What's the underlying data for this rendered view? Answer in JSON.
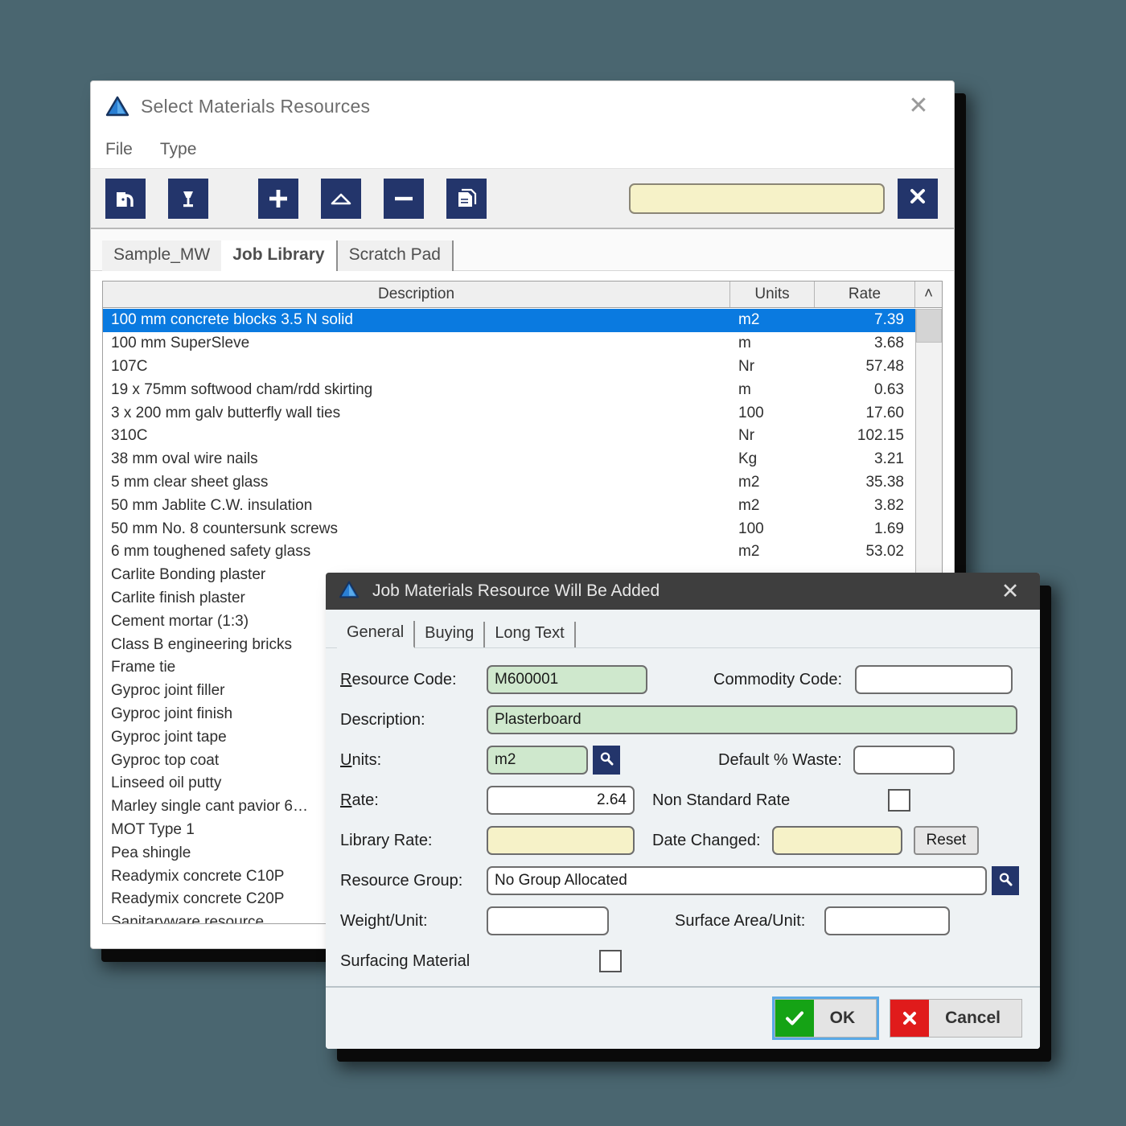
{
  "desktop": {
    "background_color": "#4a6670"
  },
  "window1": {
    "title": "Select Materials Resources",
    "icon": "triangle-app-icon",
    "close_label": "✕",
    "menu": [
      {
        "label": "File"
      },
      {
        "label": "Type"
      }
    ],
    "toolbar": {
      "buttons": [
        {
          "name": "exit-door-button",
          "icon": "exit-door-icon"
        },
        {
          "name": "lamp-button",
          "icon": "lamp-icon"
        },
        {
          "name": "add-button",
          "icon": "plus-icon"
        },
        {
          "name": "up-button",
          "icon": "triangle-up-icon"
        },
        {
          "name": "remove-button",
          "icon": "minus-icon"
        },
        {
          "name": "copy-button",
          "icon": "copy-pages-icon"
        }
      ],
      "search_value": "",
      "search_placeholder": "",
      "clear_label": "✕"
    },
    "tabs": [
      {
        "label": "Sample_MW",
        "active": false
      },
      {
        "label": "Job Library",
        "active": true
      },
      {
        "label": "Scratch Pad",
        "active": false
      }
    ],
    "list": {
      "columns": [
        "Description",
        "Units",
        "Rate"
      ],
      "scroll_up_glyph": "˄",
      "rows": [
        {
          "description": "100 mm concrete blocks 3.5 N solid",
          "units": "m2",
          "rate": "7.39",
          "selected": true
        },
        {
          "description": "100 mm SuperSleve",
          "units": "m",
          "rate": "3.68",
          "selected": false
        },
        {
          "description": "107C",
          "units": "Nr",
          "rate": "57.48",
          "selected": false
        },
        {
          "description": "19 x 75mm softwood cham/rdd skirting",
          "units": "m",
          "rate": "0.63",
          "selected": false
        },
        {
          "description": "3 x 200 mm galv butterfly wall ties",
          "units": "100",
          "rate": "17.60",
          "selected": false
        },
        {
          "description": "310C",
          "units": "Nr",
          "rate": "102.15",
          "selected": false
        },
        {
          "description": "38 mm oval wire nails",
          "units": "Kg",
          "rate": "3.21",
          "selected": false
        },
        {
          "description": "5 mm clear sheet glass",
          "units": "m2",
          "rate": "35.38",
          "selected": false
        },
        {
          "description": "50 mm Jablite C.W. insulation",
          "units": "m2",
          "rate": "3.82",
          "selected": false
        },
        {
          "description": "50 mm No. 8 countersunk screws",
          "units": "100",
          "rate": "1.69",
          "selected": false
        },
        {
          "description": "6 mm toughened safety glass",
          "units": "m2",
          "rate": "53.02",
          "selected": false
        },
        {
          "description": "Carlite Bonding plaster",
          "units": "",
          "rate": "",
          "selected": false
        },
        {
          "description": "Carlite finish plaster",
          "units": "",
          "rate": "",
          "selected": false
        },
        {
          "description": "Cement mortar (1:3)",
          "units": "",
          "rate": "",
          "selected": false
        },
        {
          "description": "Class B engineering bricks",
          "units": "",
          "rate": "",
          "selected": false
        },
        {
          "description": "Frame tie",
          "units": "",
          "rate": "",
          "selected": false
        },
        {
          "description": "Gyproc joint filler",
          "units": "",
          "rate": "",
          "selected": false
        },
        {
          "description": "Gyproc joint finish",
          "units": "",
          "rate": "",
          "selected": false
        },
        {
          "description": "Gyproc joint tape",
          "units": "",
          "rate": "",
          "selected": false
        },
        {
          "description": "Gyproc top coat",
          "units": "",
          "rate": "",
          "selected": false
        },
        {
          "description": "Linseed oil putty",
          "units": "",
          "rate": "",
          "selected": false
        },
        {
          "description": "Marley single cant pavior 6…",
          "units": "",
          "rate": "",
          "selected": false
        },
        {
          "description": "MOT Type 1",
          "units": "",
          "rate": "",
          "selected": false
        },
        {
          "description": "Pea shingle",
          "units": "",
          "rate": "",
          "selected": false
        },
        {
          "description": "Readymix concrete C10P",
          "units": "",
          "rate": "",
          "selected": false
        },
        {
          "description": "Readymix concrete C20P",
          "units": "",
          "rate": "",
          "selected": false
        },
        {
          "description": "Sanitaryware resource",
          "units": "",
          "rate": "",
          "selected": false
        }
      ]
    }
  },
  "window2": {
    "title": "Job Materials Resource Will Be Added",
    "icon": "triangle-app-icon",
    "close_label": "✕",
    "tabs": [
      {
        "label": "General",
        "active": true
      },
      {
        "label": "Buying",
        "active": false
      },
      {
        "label": "Long Text",
        "active": false
      }
    ],
    "fields": {
      "resource_code_label": "Resource Code:",
      "resource_code_value": "M600001",
      "commodity_code_label": "Commodity Code:",
      "commodity_code_value": "",
      "description_label": "Description:",
      "description_value": "Plasterboard",
      "units_label": "Units:",
      "units_value": "m2",
      "default_waste_label": "Default % Waste:",
      "default_waste_value": "",
      "rate_label": "Rate:",
      "rate_value": "2.64",
      "non_standard_rate_label": "Non Standard Rate",
      "library_rate_label": "Library Rate:",
      "library_rate_value": "",
      "date_changed_label": "Date Changed:",
      "date_changed_value": "",
      "reset_label": "Reset",
      "resource_group_label": "Resource Group:",
      "resource_group_value": "No Group Allocated",
      "weight_unit_label": "Weight/Unit:",
      "weight_unit_value": "",
      "surface_area_label": "Surface Area/Unit:",
      "surface_area_value": "",
      "surfacing_material_label": "Surfacing Material"
    },
    "footer": {
      "ok_label": "OK",
      "cancel_label": "Cancel",
      "ok_color": "#15a315",
      "cancel_color": "#e01b1b"
    }
  }
}
